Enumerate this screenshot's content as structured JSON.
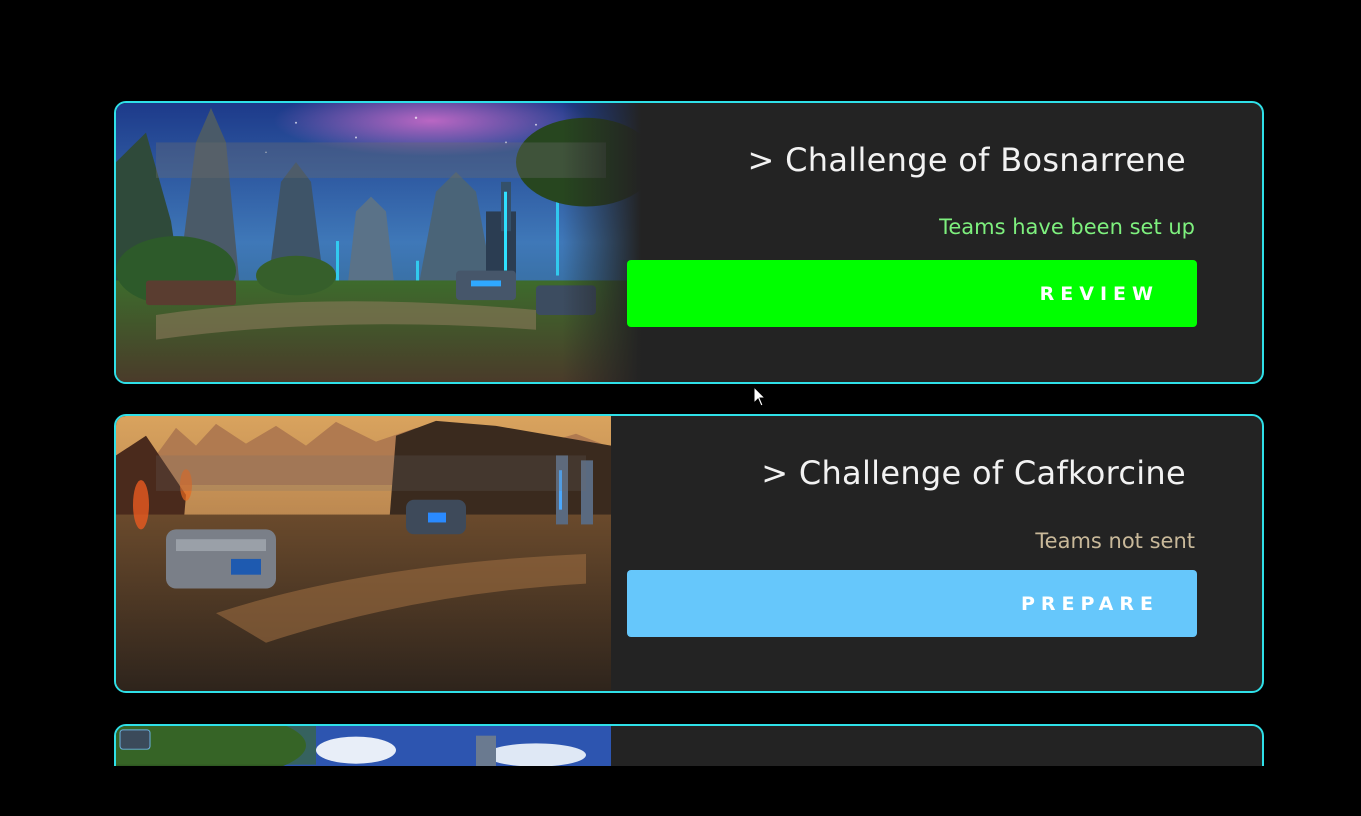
{
  "challenges": [
    {
      "title": "> Challenge of Bosnarrene",
      "status": "Teams have been set up",
      "action_label": "REVIEW",
      "action_color": "#00ff00",
      "status_color": "#7ef07e",
      "scene": "sci-fi jungle base at night"
    },
    {
      "title": "> Challenge of Cafkorcine",
      "status": "Teams not sent",
      "action_label": "PREPARE",
      "action_color": "#66c7fb",
      "status_color": "#c9b99a",
      "scene": "desert canyon outpost at dusk"
    },
    {
      "title": "",
      "status": "",
      "action_label": "",
      "scene": "forest with blue sky and towers"
    }
  ],
  "colors": {
    "background": "#000000",
    "card": "#232323",
    "card_border": "#2fe0e8"
  }
}
